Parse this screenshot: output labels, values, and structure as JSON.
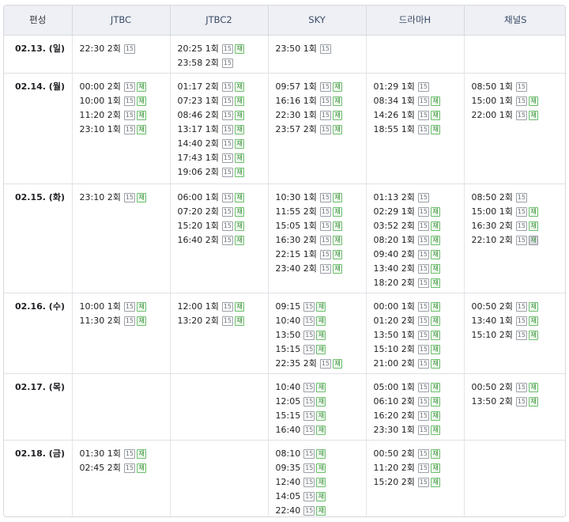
{
  "header": {
    "col_day": "편성",
    "channels": [
      "JTBC",
      "JTBC2",
      "SKY",
      "드라마H",
      "채널S"
    ]
  },
  "badges": {
    "age": "15",
    "rerun": "재"
  },
  "colors": {
    "header_bg": "#eef0f5",
    "rerun_green": "#2f8a2f",
    "border": "#d6d9de"
  },
  "rows": [
    {
      "day": "02.13. (일)",
      "cells": [
        [
          {
            "time": "22:30 2회",
            "re": false
          }
        ],
        [
          {
            "time": "20:25 1회",
            "re": true
          },
          {
            "time": "23:58 2회",
            "re": false
          }
        ],
        [
          {
            "time": "23:50 1회",
            "re": false
          }
        ],
        [],
        []
      ]
    },
    {
      "day": "02.14. (월)",
      "cells": [
        [
          {
            "time": "00:00 2회",
            "re": true
          },
          {
            "time": "10:00 1회",
            "re": true
          },
          {
            "time": "11:20 2회",
            "re": true
          },
          {
            "time": "23:10 1회",
            "re": true
          }
        ],
        [
          {
            "time": "01:17 2회",
            "re": true
          },
          {
            "time": "07:23 1회",
            "re": true
          },
          {
            "time": "08:46 2회",
            "re": true
          },
          {
            "time": "13:17 1회",
            "re": true
          },
          {
            "time": "14:40 2회",
            "re": true
          },
          {
            "time": "17:43 1회",
            "re": true
          },
          {
            "time": "19:06 2회",
            "re": true
          }
        ],
        [
          {
            "time": "09:57 1회",
            "re": true
          },
          {
            "time": "16:16 1회",
            "re": true
          },
          {
            "time": "22:30 1회",
            "re": true
          },
          {
            "time": "23:57 2회",
            "re": true
          }
        ],
        [
          {
            "time": "01:29 1회",
            "re": false
          },
          {
            "time": "08:34 1회",
            "re": true
          },
          {
            "time": "14:26 1회",
            "re": true
          },
          {
            "time": "18:55 1회",
            "re": true
          }
        ],
        [
          {
            "time": "08:50 1회",
            "re": false
          },
          {
            "time": "15:00 1회",
            "re": true
          },
          {
            "time": "22:00 1회",
            "re": true
          }
        ]
      ]
    },
    {
      "day": "02.15. (화)",
      "cells": [
        [
          {
            "time": "23:10 2회",
            "re": true
          }
        ],
        [
          {
            "time": "06:00 1회",
            "re": true
          },
          {
            "time": "07:20 2회",
            "re": true
          },
          {
            "time": "15:20 1회",
            "re": true
          },
          {
            "time": "16:40 2회",
            "re": true
          }
        ],
        [
          {
            "time": "10:30 1회",
            "re": true
          },
          {
            "time": "11:55 2회",
            "re": true
          },
          {
            "time": "15:05 1회",
            "re": true
          },
          {
            "time": "16:30 2회",
            "re": true
          },
          {
            "time": "22:15 1회",
            "re": true
          },
          {
            "time": "23:40 2회",
            "re": true
          }
        ],
        [
          {
            "time": "01:13 2회",
            "re": false
          },
          {
            "time": "02:29 1회",
            "re": true
          },
          {
            "time": "03:52 2회",
            "re": true
          },
          {
            "time": "08:20 1회",
            "re": true
          },
          {
            "time": "09:40 2회",
            "re": true
          },
          {
            "time": "13:40 2회",
            "re": true
          },
          {
            "time": "18:20 2회",
            "re": true
          }
        ],
        [
          {
            "time": "08:50 2회",
            "re": false
          },
          {
            "time": "15:00 1회",
            "re": true
          },
          {
            "time": "16:30 2회",
            "re": true
          },
          {
            "time": "22:10 2회",
            "re": true,
            "hl": true
          }
        ]
      ]
    },
    {
      "day": "02.16. (수)",
      "cells": [
        [
          {
            "time": "10:00 1회",
            "re": true
          },
          {
            "time": "11:30 2회",
            "re": true
          }
        ],
        [
          {
            "time": "12:00 1회",
            "re": true
          },
          {
            "time": "13:20 2회",
            "re": true
          }
        ],
        [
          {
            "time": "09:15",
            "re": true
          },
          {
            "time": "10:40",
            "re": true
          },
          {
            "time": "13:50",
            "re": true
          },
          {
            "time": "15:15",
            "re": true
          },
          {
            "time": "22:35 2회",
            "re": true
          }
        ],
        [
          {
            "time": "00:00 1회",
            "re": true
          },
          {
            "time": "01:20 2회",
            "re": true
          },
          {
            "time": "13:50 1회",
            "re": true
          },
          {
            "time": "15:10 2회",
            "re": true
          },
          {
            "time": "21:00 2회",
            "re": true
          }
        ],
        [
          {
            "time": "00:50 2회",
            "re": true
          },
          {
            "time": "13:40 1회",
            "re": true
          },
          {
            "time": "15:10 2회",
            "re": true
          }
        ]
      ]
    },
    {
      "day": "02.17. (목)",
      "cells": [
        [],
        [],
        [
          {
            "time": "10:40",
            "re": true
          },
          {
            "time": "12:05",
            "re": true
          },
          {
            "time": "15:15",
            "re": true
          },
          {
            "time": "16:40",
            "re": true
          }
        ],
        [
          {
            "time": "05:00 1회",
            "re": true
          },
          {
            "time": "06:10 2회",
            "re": true
          },
          {
            "time": "16:20 2회",
            "re": true
          },
          {
            "time": "23:30 1회",
            "re": true
          }
        ],
        [
          {
            "time": "00:50 2회",
            "re": true
          },
          {
            "time": "13:50 2회",
            "re": true
          }
        ]
      ]
    },
    {
      "day": "02.18. (금)",
      "cells": [
        [
          {
            "time": "01:30 1회",
            "re": true
          },
          {
            "time": "02:45 2회",
            "re": true
          }
        ],
        [],
        [
          {
            "time": "08:10",
            "re": true
          },
          {
            "time": "09:35",
            "re": true
          },
          {
            "time": "12:40",
            "re": true
          },
          {
            "time": "14:05",
            "re": true
          },
          {
            "time": "22:40",
            "re": true
          }
        ],
        [
          {
            "time": "00:50 2회",
            "re": true
          },
          {
            "time": "11:20 2회",
            "re": true
          },
          {
            "time": "15:20 2회",
            "re": true
          }
        ],
        []
      ]
    }
  ]
}
